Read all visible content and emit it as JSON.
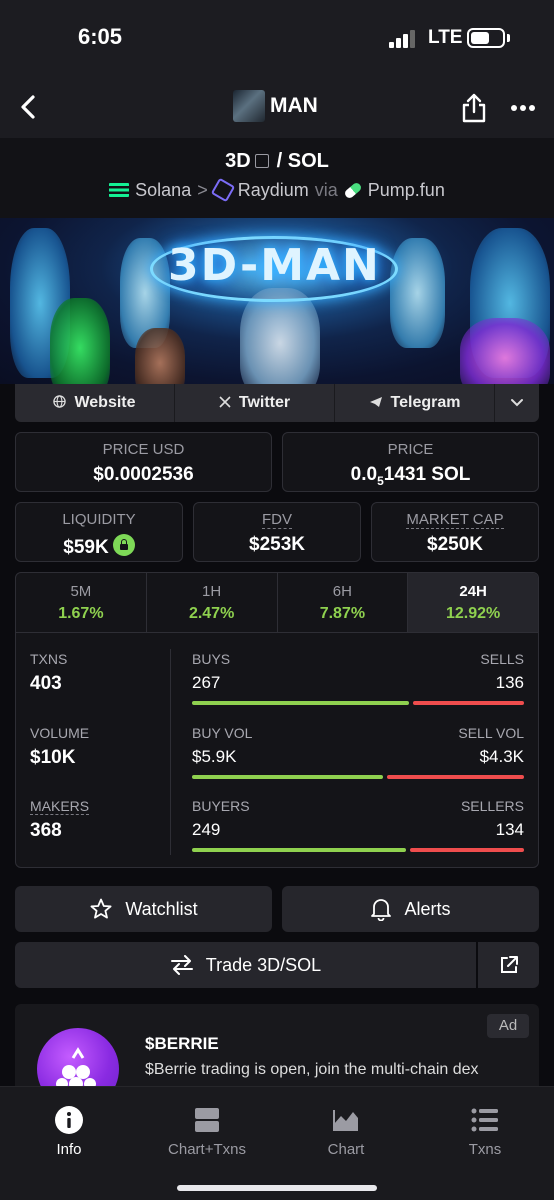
{
  "status": {
    "time": "6:05",
    "network": "LTE"
  },
  "nav": {
    "title": "MAN",
    "back_icon": "chevron-left-icon",
    "share_icon": "share-icon",
    "more_icon": "ellipsis-icon"
  },
  "pair": {
    "base": "3D",
    "quote": "/ SOL",
    "chain": "Solana",
    "dex": "Raydium",
    "via": "via",
    "launchpad": "Pump.fun"
  },
  "banner": {
    "title": "3D-MAN"
  },
  "links": {
    "website": "Website",
    "twitter": "Twitter",
    "telegram": "Telegram"
  },
  "price": {
    "usd_label": "PRICE USD",
    "usd_value": "$0.0002536",
    "native_label": "PRICE",
    "native_prefix": "0.0",
    "native_sub": "5",
    "native_suffix": "1431 SOL"
  },
  "metrics": {
    "liquidity_label": "LIQUIDITY",
    "liquidity_value": "$59K",
    "fdv_label": "FDV",
    "fdv_value": "$253K",
    "mcap_label": "MARKET CAP",
    "mcap_value": "$250K"
  },
  "timeframes": [
    {
      "label": "5M",
      "change": "1.67%"
    },
    {
      "label": "1H",
      "change": "2.47%"
    },
    {
      "label": "6H",
      "change": "7.87%"
    },
    {
      "label": "24H",
      "change": "12.92%"
    }
  ],
  "active_timeframe": "24H",
  "stats": {
    "txns_label": "TXNS",
    "txns_value": "403",
    "volume_label": "VOLUME",
    "volume_value": "$10K",
    "makers_label": "MAKERS",
    "makers_value": "368",
    "buys_label": "BUYS",
    "buys_value": "267",
    "sells_label": "SELLS",
    "sells_value": "136",
    "buy_vol_label": "BUY VOL",
    "buy_vol_value": "$5.9K",
    "sell_vol_label": "SELL VOL",
    "sell_vol_value": "$4.3K",
    "buyers_label": "BUYERS",
    "buyers_value": "249",
    "sellers_label": "SELLERS",
    "sellers_value": "134",
    "buys_ratio": 0.66,
    "buy_vol_ratio": 0.58,
    "buyers_ratio": 0.65
  },
  "actions": {
    "watchlist": "Watchlist",
    "alerts": "Alerts",
    "trade": "Trade 3D/SOL"
  },
  "ad": {
    "badge": "Ad",
    "title": "$BERRIE",
    "text": "$Berrie trading is open, join the multi-chain dex"
  },
  "tabbar": [
    {
      "label": "Info",
      "icon": "info-icon"
    },
    {
      "label": "Chart+Txns",
      "icon": "split-view-icon"
    },
    {
      "label": "Chart",
      "icon": "area-chart-icon"
    },
    {
      "label": "Txns",
      "icon": "list-icon"
    }
  ],
  "colors": {
    "positive": "#8fd14f",
    "negative": "#ef4d4d",
    "accent": "#7ed957"
  }
}
